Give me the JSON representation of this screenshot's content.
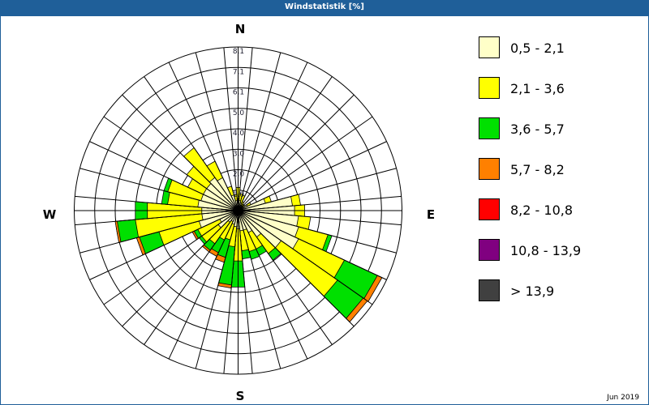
{
  "header": {
    "title": "Windstatistik [%]"
  },
  "footer": {
    "date": "Jun 2019"
  },
  "chart_data": {
    "type": "polar-stacked-bar",
    "title": "Windstatistik [%]",
    "compass": {
      "n": "N",
      "e": "E",
      "s": "S",
      "w": "W"
    },
    "ring_labels": [
      "1,0",
      "2,0",
      "3,0",
      "4,0",
      "5,0",
      "6,1",
      "7,1",
      "8,1"
    ],
    "rmax": 8.1,
    "directions_deg": [
      0,
      10,
      20,
      30,
      40,
      50,
      60,
      70,
      80,
      90,
      100,
      110,
      120,
      130,
      140,
      150,
      160,
      170,
      180,
      190,
      200,
      210,
      220,
      230,
      240,
      250,
      260,
      270,
      280,
      290,
      300,
      310,
      320,
      330,
      340,
      350
    ],
    "series": [
      {
        "name": "0,5 - 2,1",
        "color": "#ffffc8",
        "values": [
          0.6,
          0.5,
          0.4,
          0.3,
          0.3,
          0.3,
          0.5,
          1.4,
          2.7,
          2.8,
          3.0,
          3.1,
          3.3,
          2.6,
          1.6,
          1.2,
          1.0,
          1.0,
          0.9,
          0.8,
          0.7,
          0.6,
          0.7,
          1.2,
          1.0,
          2.0,
          1.8,
          1.8,
          2.0,
          1.9,
          1.9,
          1.9,
          2.0,
          1.8,
          0.8,
          0.5
        ]
      },
      {
        "name": "2,1 - 3,6",
        "color": "#ffff00",
        "values": [
          0.55,
          0.35,
          0.4,
          0.2,
          0.1,
          0.1,
          0.2,
          0.3,
          0.4,
          0.5,
          0.6,
          1.5,
          2.5,
          3.4,
          1.0,
          0.9,
          1.1,
          1.0,
          1.6,
          1.0,
          0.8,
          1.0,
          1.3,
          1.0,
          1.2,
          2.05,
          3.3,
          2.7,
          1.5,
          1.7,
          0.85,
          1.2,
          1.8,
          0.9,
          0.45,
          0.3
        ]
      },
      {
        "name": "3,6 - 5,7",
        "color": "#00e000",
        "values": [
          0,
          0,
          0,
          0,
          0,
          0,
          0,
          0,
          0,
          0,
          0,
          0.2,
          1.8,
          1.55,
          0.4,
          0.35,
          0.4,
          0.4,
          1.3,
          1.9,
          0.9,
          0.7,
          0.4,
          0.15,
          0.2,
          1.0,
          0.9,
          0.6,
          0.3,
          0.2,
          0,
          0,
          0,
          0,
          0,
          0
        ]
      },
      {
        "name": "5,7 - 8,2",
        "color": "#ff8000",
        "values": [
          0,
          0,
          0,
          0,
          0,
          0,
          0,
          0,
          0,
          0,
          0,
          0,
          0.25,
          0.25,
          0,
          0,
          0,
          0,
          0,
          0.15,
          0.25,
          0.2,
          0.1,
          0,
          0.1,
          0.15,
          0.1,
          0,
          0,
          0,
          0,
          0,
          0,
          0,
          0,
          0
        ]
      },
      {
        "name": "8,2 - 10,8",
        "color": "#ff0000",
        "values": [
          0,
          0,
          0,
          0,
          0,
          0,
          0,
          0,
          0,
          0,
          0,
          0,
          0,
          0,
          0,
          0,
          0,
          0,
          0,
          0,
          0,
          0,
          0,
          0,
          0,
          0,
          0,
          0,
          0,
          0,
          0,
          0,
          0,
          0,
          0,
          0
        ]
      },
      {
        "name": "10,8 - 13,9",
        "color": "#800080",
        "values": [
          0,
          0,
          0,
          0,
          0,
          0,
          0,
          0,
          0,
          0,
          0,
          0,
          0,
          0,
          0,
          0,
          0,
          0,
          0,
          0,
          0,
          0,
          0,
          0,
          0,
          0,
          0,
          0,
          0,
          0,
          0,
          0,
          0,
          0,
          0,
          0
        ]
      },
      {
        "name": " > 13,9",
        "color": "#404040",
        "values": [
          0,
          0,
          0,
          0,
          0,
          0,
          0,
          0,
          0,
          0,
          0,
          0,
          0,
          0,
          0,
          0,
          0,
          0,
          0,
          0,
          0,
          0,
          0,
          0,
          0,
          0,
          0,
          0,
          0,
          0,
          0,
          0,
          0,
          0,
          0,
          0
        ]
      }
    ],
    "legend": {
      "position": "right"
    },
    "grid": true
  }
}
